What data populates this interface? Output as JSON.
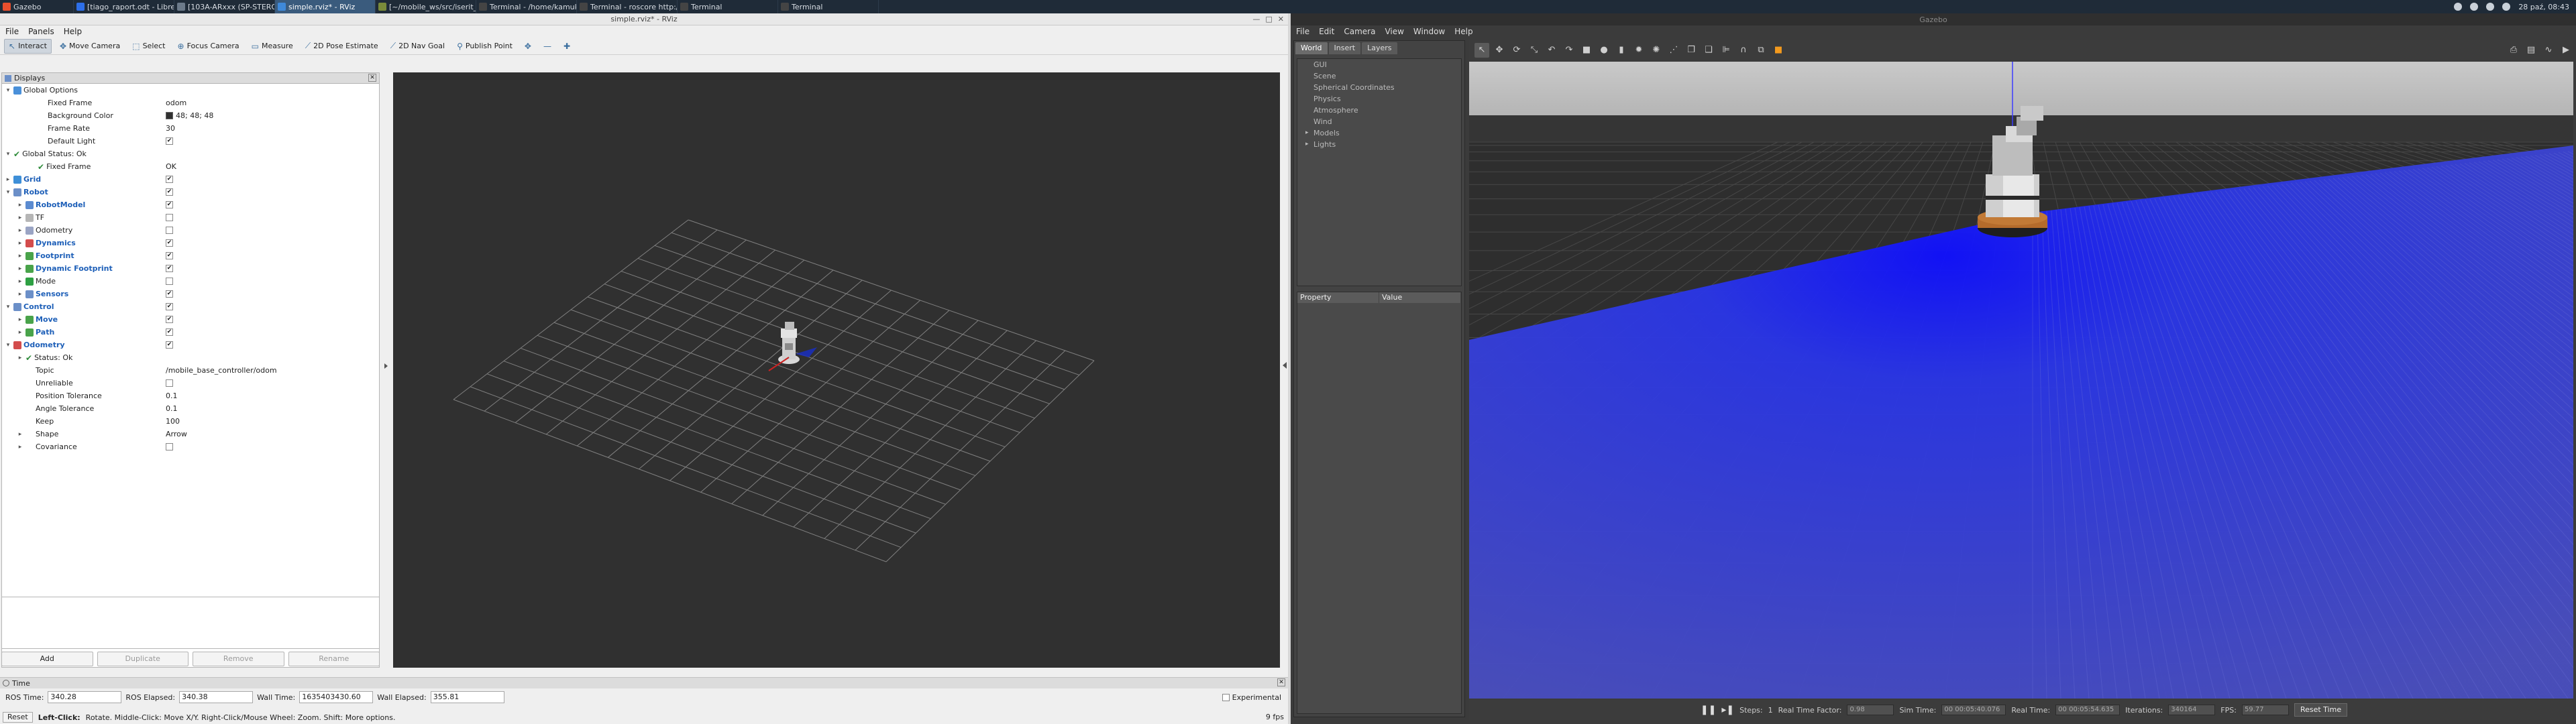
{
  "taskbar": {
    "items": [
      {
        "label": "Gazebo",
        "color": "#e94f2d",
        "active": false
      },
      {
        "label": "[tiago_raport.odt - LibreOff...",
        "color": "#2d6fe9",
        "active": false
      },
      {
        "label": "[103A-ARxxx (SP-STEROK2...",
        "color": "#6c7a8a",
        "active": false
      },
      {
        "label": "simple.rviz* - RViz",
        "color": "#3f89d9",
        "active": true
      },
      {
        "label": "[~/mobile_ws/src/iserit_m...",
        "color": "#7a8b3a",
        "active": false
      },
      {
        "label": "Terminal - /home/kamuku/...",
        "color": "#444444",
        "active": false
      },
      {
        "label": "Terminal - roscore http://n...",
        "color": "#444444",
        "active": false
      },
      {
        "label": "Terminal",
        "color": "#444444",
        "active": false
      },
      {
        "label": "Terminal",
        "color": "#444444",
        "active": false
      }
    ],
    "clock": "28 paź, 08:43"
  },
  "rviz": {
    "title": "simple.rviz* - RViz",
    "menu": [
      "File",
      "Panels",
      "Help"
    ],
    "tools": [
      {
        "label": "Interact",
        "glyph": "↖",
        "active": true
      },
      {
        "label": "Move Camera",
        "glyph": "✥",
        "active": false
      },
      {
        "label": "Select",
        "glyph": "⬚",
        "active": false
      },
      {
        "label": "Focus Camera",
        "glyph": "⊕",
        "active": false
      },
      {
        "label": "Measure",
        "glyph": "▭",
        "active": false
      },
      {
        "label": "2D Pose Estimate",
        "glyph": "⟋",
        "active": false
      },
      {
        "label": "2D Nav Goal",
        "glyph": "⟋",
        "active": false
      },
      {
        "label": "Publish Point",
        "glyph": "⚲",
        "active": false
      }
    ],
    "displays_title": "Displays",
    "tree": [
      {
        "indent": 0,
        "tw": "▾",
        "icon": "#4a90d9",
        "label": "Global Options",
        "bold": false,
        "val": ""
      },
      {
        "indent": 2,
        "tw": "",
        "icon": "",
        "label": "Fixed Frame",
        "bold": false,
        "val": "odom"
      },
      {
        "indent": 2,
        "tw": "",
        "icon": "",
        "label": "Background Color",
        "bold": false,
        "val": "48; 48; 48",
        "swatch": true
      },
      {
        "indent": 2,
        "tw": "",
        "icon": "",
        "label": "Frame Rate",
        "bold": false,
        "val": "30"
      },
      {
        "indent": 2,
        "tw": "",
        "icon": "",
        "label": "Default Light",
        "bold": false,
        "check": true
      },
      {
        "indent": 0,
        "tw": "▾",
        "icon": "ok",
        "label": "Global Status: Ok",
        "bold": false,
        "val": ""
      },
      {
        "indent": 2,
        "tw": "",
        "icon": "ok",
        "label": "Fixed Frame",
        "bold": false,
        "val": "OK"
      },
      {
        "indent": 0,
        "tw": "▸",
        "icon": "#3e8fd8",
        "label": "Grid",
        "bold": true,
        "check": true
      },
      {
        "indent": 0,
        "tw": "▾",
        "icon": "#6b8fc8",
        "label": "Robot",
        "bold": true,
        "check": true
      },
      {
        "indent": 1,
        "tw": "▸",
        "icon": "#5b8bd0",
        "label": "RobotModel",
        "bold": true,
        "check": true
      },
      {
        "indent": 1,
        "tw": "▸",
        "icon": "#b6b6b6",
        "label": "TF",
        "bold": false,
        "check": false
      },
      {
        "indent": 1,
        "tw": "▸",
        "icon": "#9aa4c4",
        "label": "Odometry",
        "bold": false,
        "check": false
      },
      {
        "indent": 1,
        "tw": "▸",
        "icon": "#d34c4c",
        "label": "Dynamics",
        "bold": true,
        "check": true
      },
      {
        "indent": 1,
        "tw": "▸",
        "icon": "#49a34a",
        "label": "Footprint",
        "bold": true,
        "check": true
      },
      {
        "indent": 1,
        "tw": "▸",
        "icon": "#49a34a",
        "label": "Dynamic Footprint",
        "bold": true,
        "check": true
      },
      {
        "indent": 1,
        "tw": "▸",
        "icon": "#2ea043",
        "label": "Mode",
        "bold": false,
        "check": false
      },
      {
        "indent": 1,
        "tw": "▸",
        "icon": "#6b8fc8",
        "label": "Sensors",
        "bold": true,
        "check": true
      },
      {
        "indent": 0,
        "tw": "▾",
        "icon": "#6b8fc8",
        "label": "Control",
        "bold": true,
        "check": true
      },
      {
        "indent": 1,
        "tw": "▸",
        "icon": "#49a34a",
        "label": "Move",
        "bold": true,
        "check": true
      },
      {
        "indent": 1,
        "tw": "▸",
        "icon": "#49a34a",
        "label": "Path",
        "bold": true,
        "check": true
      },
      {
        "indent": 0,
        "tw": "▾",
        "icon": "#d34c4c",
        "label": "Odometry",
        "bold": true,
        "check": true
      },
      {
        "indent": 1,
        "tw": "▸",
        "icon": "ok",
        "label": "Status: Ok",
        "bold": false,
        "val": ""
      },
      {
        "indent": 1,
        "tw": "",
        "icon": "",
        "label": "Topic",
        "bold": false,
        "val": "/mobile_base_controller/odom"
      },
      {
        "indent": 1,
        "tw": "",
        "icon": "",
        "label": "Unreliable",
        "bold": false,
        "check": false
      },
      {
        "indent": 1,
        "tw": "",
        "icon": "",
        "label": "Position Tolerance",
        "bold": false,
        "val": "0.1"
      },
      {
        "indent": 1,
        "tw": "",
        "icon": "",
        "label": "Angle Tolerance",
        "bold": false,
        "val": "0.1"
      },
      {
        "indent": 1,
        "tw": "",
        "icon": "",
        "label": "Keep",
        "bold": false,
        "val": "100"
      },
      {
        "indent": 1,
        "tw": "▸",
        "icon": "",
        "label": "Shape",
        "bold": false,
        "val": "Arrow"
      },
      {
        "indent": 1,
        "tw": "▸",
        "icon": "",
        "label": "Covariance",
        "bold": false,
        "check": false
      }
    ],
    "buttons": [
      {
        "label": "Add",
        "disabled": false
      },
      {
        "label": "Duplicate",
        "disabled": true
      },
      {
        "label": "Remove",
        "disabled": true
      },
      {
        "label": "Rename",
        "disabled": true
      }
    ],
    "time": {
      "title": "Time",
      "ros_time_label": "ROS Time:",
      "ros_time": "340.28",
      "ros_elapsed_label": "ROS Elapsed:",
      "ros_elapsed": "340.38",
      "wall_time_label": "Wall Time:",
      "wall_time": "1635403430.60",
      "wall_elapsed_label": "Wall Elapsed:",
      "wall_elapsed": "355.81",
      "experimental": "Experimental"
    },
    "status": {
      "reset": "Reset",
      "hint_bold": "Left-Click:",
      "hint": "Rotate. Middle-Click: Move X/Y. Right-Click/Mouse Wheel: Zoom. Shift: More options.",
      "fps": "9 fps"
    }
  },
  "gazebo": {
    "title": "Gazebo",
    "menu": [
      "File",
      "Edit",
      "Camera",
      "View",
      "Window",
      "Help"
    ],
    "tabs": [
      "World",
      "Insert",
      "Layers"
    ],
    "world_items": [
      {
        "label": "GUI",
        "arrow": ""
      },
      {
        "label": "Scene",
        "arrow": ""
      },
      {
        "label": "Spherical Coordinates",
        "arrow": ""
      },
      {
        "label": "Physics",
        "arrow": ""
      },
      {
        "label": "Atmosphere",
        "arrow": ""
      },
      {
        "label": "Wind",
        "arrow": ""
      },
      {
        "label": "Models",
        "arrow": "▸"
      },
      {
        "label": "Lights",
        "arrow": "▸"
      }
    ],
    "prop_cols": [
      "Property",
      "Value"
    ],
    "bottom": {
      "steps_label": "Steps:",
      "steps": "1",
      "rtf_label": "Real Time Factor:",
      "rtf": "0.98",
      "sim_label": "Sim Time:",
      "sim": "00 00:05:40.076",
      "real_label": "Real Time:",
      "real": "00 00:05:54.635",
      "iter_label": "Iterations:",
      "iter": "340164",
      "fps_label": "FPS:",
      "fps": "59.77",
      "reset": "Reset Time"
    }
  }
}
